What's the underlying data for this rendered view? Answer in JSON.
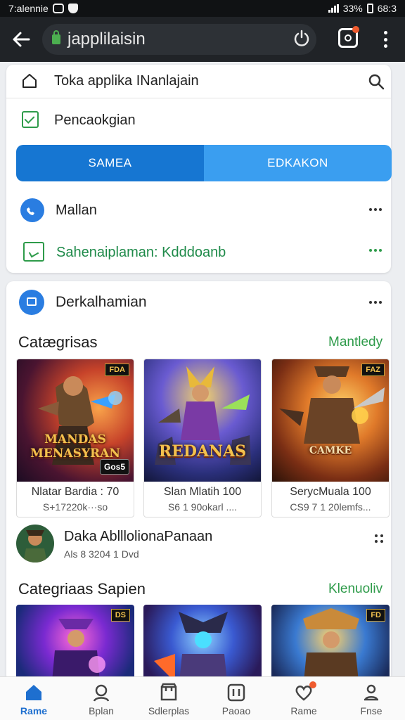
{
  "status_bar": {
    "carrier": "7:alennie",
    "battery": "33%",
    "time": "68:3"
  },
  "toolbar": {
    "url": "japplilaisin"
  },
  "search": {
    "text": "Toka applika INanlajain"
  },
  "check_row": {
    "label": "Pencaokgian"
  },
  "segmented": {
    "left": "SAMEA",
    "right": "EDKAKON"
  },
  "list": {
    "mallan": "Mallan",
    "sahen": "Sahenaiplaman: Kdddoanb"
  },
  "section_header": {
    "label": "Derkalhamian"
  },
  "categories": {
    "title": "Catægrisas",
    "more": "Mantledy",
    "games": [
      {
        "art_title": "MANDAS MENASYRAN",
        "badge": "FDA",
        "badge2": "Gos5",
        "name": "Nlatar Bardia : 70",
        "meta": "S+17220k···so"
      },
      {
        "art_title": "REDANAS",
        "badge": "",
        "badge2": "",
        "name": "Slan Mlatih 100",
        "meta": "S6 1 90okarl ...."
      },
      {
        "art_title": "CAMKE",
        "badge": "FAZ",
        "badge2": "",
        "name": "SerycMuala 100",
        "meta": "CS9 7 1 20lemfs..."
      }
    ]
  },
  "developer": {
    "name": "Daka AblllolionaPanaan",
    "meta": "Als 8 3204 1 Dvd"
  },
  "categories2": {
    "title": "Categriaas Sapien",
    "more": "Klenuoliv",
    "badge1": "DS",
    "badge3": "FD"
  },
  "bottom_nav": [
    {
      "label": "Rame",
      "icon": "home-icon"
    },
    {
      "label": "Bplan",
      "icon": "person-icon"
    },
    {
      "label": "Sdlerplas",
      "icon": "store-icon"
    },
    {
      "label": "Paoao",
      "icon": "apps-icon"
    },
    {
      "label": "Rame",
      "icon": "heart-icon"
    },
    {
      "label": "Fnse",
      "icon": "profile-icon"
    }
  ],
  "colors": {
    "accent": "#1676d2",
    "accent_light": "#3a9ef0",
    "green": "#2e9b4a",
    "toolbar": "#202327"
  }
}
